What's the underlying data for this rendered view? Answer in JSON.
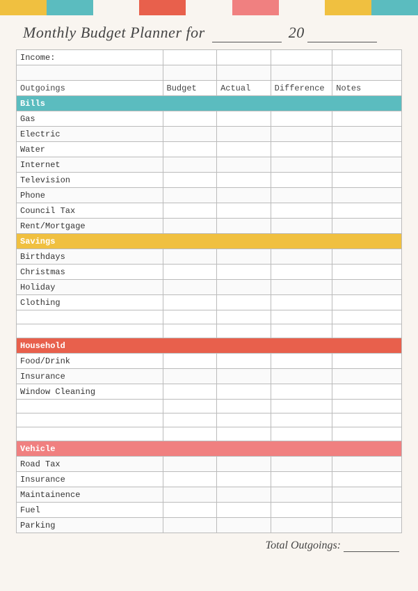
{
  "colors": {
    "teal": "#5bbcbf",
    "yellow": "#f0c040",
    "coral": "#e8604c",
    "pink": "#f08080",
    "red": "#e04040",
    "orange": "#f5a623",
    "bg": "#f9f5f0"
  },
  "title": {
    "prefix": "Monthly Budget Planner for",
    "year_prefix": "20",
    "line": "________",
    "year_suffix": "__"
  },
  "table": {
    "income_label": "Income:",
    "columns": {
      "outgoings": "Outgoings",
      "budget": "Budget",
      "actual": "Actual",
      "difference": "Difference",
      "notes": "Notes"
    },
    "categories": [
      {
        "name": "Bills",
        "type": "cat-bills",
        "items": [
          "Gas",
          "Electric",
          "Water",
          "Internet",
          "Television",
          "Phone",
          "Council Tax",
          "Rent/Mortgage"
        ],
        "extra_empty": 0
      },
      {
        "name": "Savings",
        "type": "cat-savings",
        "items": [
          "Birthdays",
          "Christmas",
          "Holiday",
          "Clothing"
        ],
        "extra_empty": 2
      },
      {
        "name": "Household",
        "type": "cat-household",
        "items": [
          "Food/Drink",
          "Insurance",
          "Window Cleaning"
        ],
        "extra_empty": 3
      },
      {
        "name": "Vehicle",
        "type": "cat-vehicle",
        "items": [
          "Road Tax",
          "Insurance",
          "Maintainence",
          "Fuel",
          "Parking"
        ],
        "extra_empty": 0
      }
    ]
  },
  "total": {
    "label": "Total Outgoings:",
    "line": "______"
  }
}
